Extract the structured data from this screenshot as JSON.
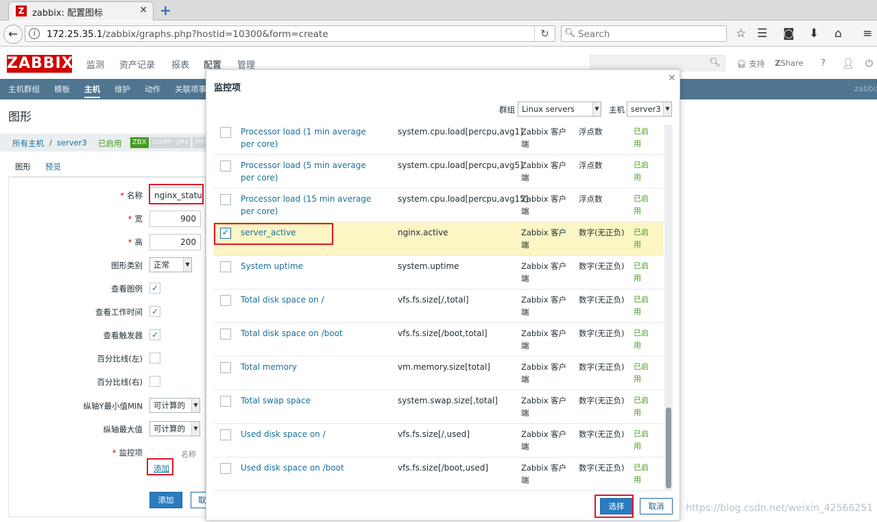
{
  "browser": {
    "tab_title": "zabbix: 配置图标",
    "favicon_letter": "Z",
    "url_host": "172.25.35.1",
    "url_path": "/zabbix/graphs.php?hostid=10300&form=create",
    "search_placeholder": "Search"
  },
  "zabbix": {
    "logo": "ZABBIX",
    "main_menu": [
      "监测",
      "资产记录",
      "报表",
      "配置",
      "管理"
    ],
    "header_links": {
      "support": "支持",
      "share": "Share",
      "help": "?"
    },
    "sub_menu": [
      "主机群组",
      "模板",
      "主机",
      "维护",
      "动作",
      "关联项事"
    ],
    "sub_menu_active": "主机",
    "right_label": "zabbix",
    "accent_red": "#d40000"
  },
  "page": {
    "title": "图形",
    "breadcrumb": {
      "all_hosts": "所有主机",
      "sep": "/",
      "host": "server3",
      "status": "已启用"
    },
    "badges": [
      "ZBX",
      "SNMP",
      "JMX",
      "IPM"
    ],
    "form_tabs": [
      "图形",
      "预览"
    ],
    "form": {
      "name_label": "名称",
      "name_value": "nginx_status",
      "width_label": "宽",
      "width_value": "900",
      "height_label": "高",
      "height_value": "200",
      "graph_type_label": "图形类别",
      "graph_type_value": "正常",
      "show_legend_label": "查看图例",
      "show_worktime_label": "查看工作时间",
      "show_triggers_label": "查看触发器",
      "percentile_left_label": "百分比线(左)",
      "percentile_right_label": "百分比线(右)",
      "ymin_label": "纵轴Y最小值MIN",
      "ymin_value": "可计算的",
      "ymax_label": "纵轴最大值",
      "ymax_value": "可计算的",
      "items_label": "监控项",
      "items_col_name": "名称",
      "add_link": "添加",
      "add_button": "添加",
      "cancel_button_partial": "取"
    }
  },
  "modal": {
    "title": "监控项",
    "group_label": "群组",
    "group_value": "Linux servers",
    "host_label": "主机",
    "host_value": "server3",
    "rows": [
      {
        "name": "Processor load (1 min average per core)",
        "key": "system.cpu.load[percpu,avg1]",
        "type": "Zabbix 客户端",
        "value_type": "浮点数",
        "status": "已启用",
        "checked": false
      },
      {
        "name": "Processor load (5 min average per core)",
        "key": "system.cpu.load[percpu,avg5]",
        "type": "Zabbix 客户端",
        "value_type": "浮点数",
        "status": "已启用",
        "checked": false
      },
      {
        "name": "Processor load (15 min average per core)",
        "key": "system.cpu.load[percpu,avg15]",
        "type": "Zabbix 客户端",
        "value_type": "浮点数",
        "status": "已启用",
        "checked": false
      },
      {
        "name": "server_active",
        "key": "nginx.active",
        "type": "Zabbix 客户端",
        "value_type": "数字(无正负)",
        "status": "已启用",
        "checked": true
      },
      {
        "name": "System uptime",
        "key": "system.uptime",
        "type": "Zabbix 客户端",
        "value_type": "数字(无正负)",
        "status": "已启用",
        "checked": false
      },
      {
        "name": "Total disk space on /",
        "key": "vfs.fs.size[/,total]",
        "type": "Zabbix 客户端",
        "value_type": "数字(无正负)",
        "status": "已启用",
        "checked": false
      },
      {
        "name": "Total disk space on /boot",
        "key": "vfs.fs.size[/boot,total]",
        "type": "Zabbix 客户端",
        "value_type": "数字(无正负)",
        "status": "已启用",
        "checked": false
      },
      {
        "name": "Total memory",
        "key": "vm.memory.size[total]",
        "type": "Zabbix 客户端",
        "value_type": "数字(无正负)",
        "status": "已启用",
        "checked": false
      },
      {
        "name": "Total swap space",
        "key": "system.swap.size[,total]",
        "type": "Zabbix 客户端",
        "value_type": "数字(无正负)",
        "status": "已启用",
        "checked": false
      },
      {
        "name": "Used disk space on /",
        "key": "vfs.fs.size[/,used]",
        "type": "Zabbix 客户端",
        "value_type": "数字(无正负)",
        "status": "已启用",
        "checked": false
      },
      {
        "name": "Used disk space on /boot",
        "key": "vfs.fs.size[/boot,used]",
        "type": "Zabbix 客户端",
        "value_type": "数字(无正负)",
        "status": "已启用",
        "checked": false
      }
    ],
    "select_button": "选择",
    "cancel_button": "取消",
    "row_highlight_color": "#fcf5c4",
    "status_color": "#479b22",
    "link_color": "#1a6f9c"
  },
  "watermark": "https://blog.csdn.net/weixin_42566251"
}
